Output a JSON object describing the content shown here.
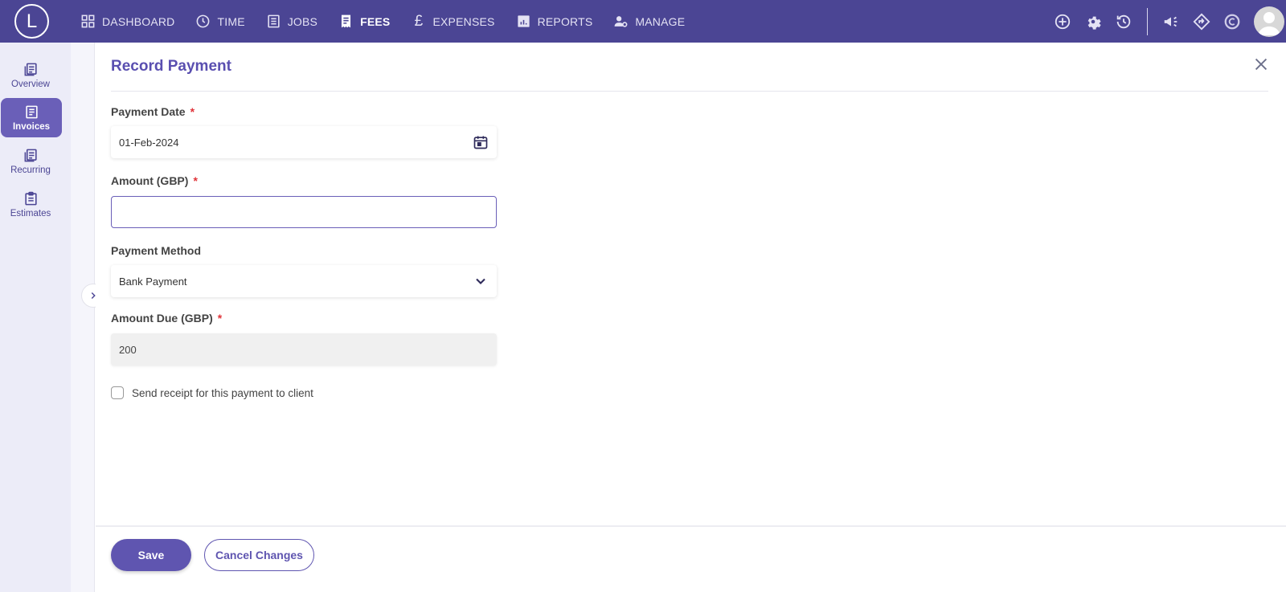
{
  "app": {
    "logo_letter": "L"
  },
  "nav": {
    "items": [
      {
        "label": "DASHBOARD",
        "icon": "dashboard-icon"
      },
      {
        "label": "TIME",
        "icon": "clock-icon"
      },
      {
        "label": "JOBS",
        "icon": "jobs-icon"
      },
      {
        "label": "FEES",
        "icon": "receipt-icon",
        "active": true
      },
      {
        "label": "EXPENSES",
        "icon": "pound-icon",
        "glyph": "£"
      },
      {
        "label": "REPORTS",
        "icon": "reports-icon"
      },
      {
        "label": "MANAGE",
        "icon": "manage-icon"
      }
    ]
  },
  "sidebar": {
    "items": [
      {
        "label": "Overview",
        "icon": "overview-icon"
      },
      {
        "label": "Invoices",
        "icon": "invoices-icon",
        "active": true
      },
      {
        "label": "Recurring",
        "icon": "recurring-icon"
      },
      {
        "label": "Estimates",
        "icon": "estimates-icon"
      }
    ]
  },
  "form": {
    "title": "Record Payment",
    "payment_date": {
      "label": "Payment Date",
      "required": "*",
      "value": "01-Feb-2024"
    },
    "amount": {
      "label": "Amount (GBP)",
      "required": "*",
      "value": "",
      "placeholder": ""
    },
    "payment_method": {
      "label": "Payment Method",
      "value": "Bank Payment"
    },
    "amount_due": {
      "label": "Amount Due (GBP)",
      "required": "*",
      "value": "200"
    },
    "send_receipt": {
      "label": "Send receipt for this payment to client",
      "checked": false
    }
  },
  "footer": {
    "save_label": "Save",
    "cancel_label": "Cancel Changes"
  },
  "colors": {
    "topbar": "#4b4594",
    "accent": "#5f55b0",
    "sidebar_bg": "#ececf8",
    "required": "#e0343a"
  }
}
